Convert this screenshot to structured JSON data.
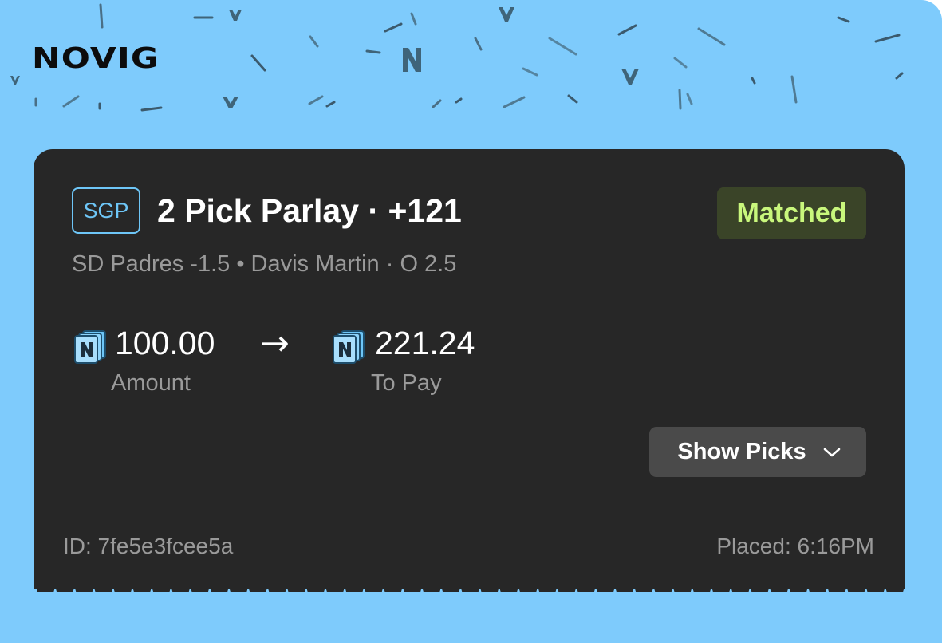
{
  "brand": {
    "logo_text": "NOVIG"
  },
  "bet": {
    "badge": "SGP",
    "title": "2 Pick Parlay · +121",
    "status": "Matched",
    "legs": "SD Padres -1.5 • Davis Martin · O 2.5",
    "stake": {
      "value": "100.00",
      "label": "Amount"
    },
    "payout": {
      "value": "221.24",
      "label": "To Pay"
    },
    "show_picks_label": "Show Picks",
    "id_text": "ID: 7fe5e3fcee5a",
    "placed_text": "Placed: 6:16PM"
  },
  "icons": {
    "coin": "novig-coin-icon",
    "arrow": "right-arrow-icon",
    "chevron": "chevron-down-icon"
  },
  "colors": {
    "background": "#7ecbfc",
    "card": "#272727",
    "accent_blue": "#6ec6f7",
    "matched_text": "#c9f77c",
    "matched_bg": "#3a4428",
    "button_bg": "#4a4a4a",
    "muted_text": "#9a9a9a"
  }
}
